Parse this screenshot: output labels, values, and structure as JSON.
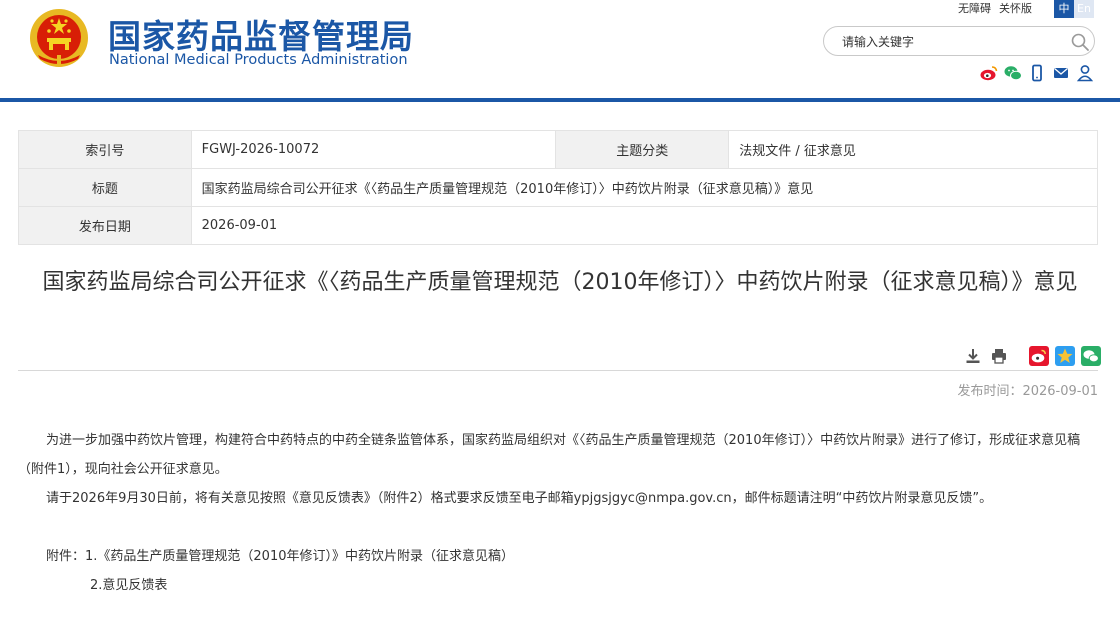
{
  "header": {
    "title_cn": "国家药品监督管理局",
    "title_en": "National Medical Products Administration",
    "top_links": [
      "无障碍",
      "关怀版"
    ],
    "lang": {
      "active": "中",
      "inactive": "En"
    },
    "search_placeholder": "请输入关键字",
    "brand_color": "#1b57a6",
    "social_icons": [
      "weibo-icon",
      "wechat-icon",
      "mobile-icon",
      "mail-icon",
      "user-icon"
    ]
  },
  "info": {
    "index_label": "索引号",
    "index_value": "FGWJ-2026-10072",
    "category_label": "主题分类",
    "category_value": "法规文件 / 征求意见",
    "title_label": "标题",
    "title_value": "国家药监局综合司公开征求《〈药品生产质量管理规范（2010年修订）〉中药饮片附录（征求意见稿）》意见",
    "date_label": "发布日期",
    "date_value": "2026-09-01"
  },
  "article": {
    "title": "国家药监局综合司公开征求《〈药品生产质量管理规范（2010年修订）〉中药饮片附录（征求意见稿）》意见",
    "pub_time": "发布时间：2026-09-01",
    "paragraphs": [
      "为进一步加强中药饮片管理，构建符合中药特点的中药全链条监管体系，国家药监局组织对《〈药品生产质量管理规范（2010年修订）〉中药饮片附录》进行了修订，形成征求意见稿（附件1），现向社会公开征求意见。",
      "请于2026年9月30日前，将有关意见按照《意见反馈表》（附件2）格式要求反馈至电子邮箱ypjgsjgyc@nmpa.gov.cn，邮件标题请注明“中药饮片附录意见反馈”。"
    ],
    "attachment_1": "附件：1.《药品生产质量管理规范（2010年修订）》中药饮片附录（征求意见稿）",
    "attachment_2": "2.意见反馈表",
    "tool_icons": [
      "download-icon",
      "print-icon",
      "weibo-share-icon",
      "qzone-share-icon",
      "wechat-share-icon"
    ]
  }
}
